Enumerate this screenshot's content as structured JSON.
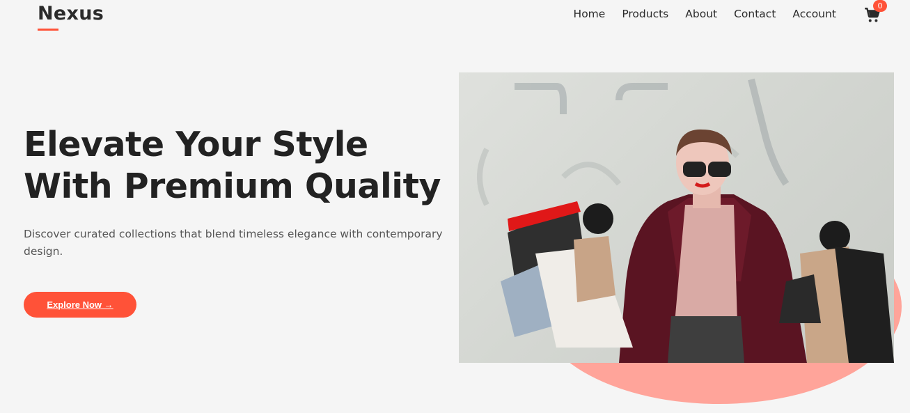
{
  "header": {
    "logo": "Nexus",
    "nav": [
      "Home",
      "Products",
      "About",
      "Contact",
      "Account"
    ],
    "cart_count": "0"
  },
  "hero": {
    "title_line1": "Elevate Your Style",
    "title_line2": "With Premium Quality",
    "subtitle": "Discover curated collections that blend timeless elegance with contemporary design.",
    "cta_label": "Explore Now →"
  },
  "colors": {
    "accent": "#ff5238",
    "blob": "#ffa49a",
    "background": "#f5f5f5"
  },
  "icons": {
    "cart": "shopping-cart-icon"
  }
}
